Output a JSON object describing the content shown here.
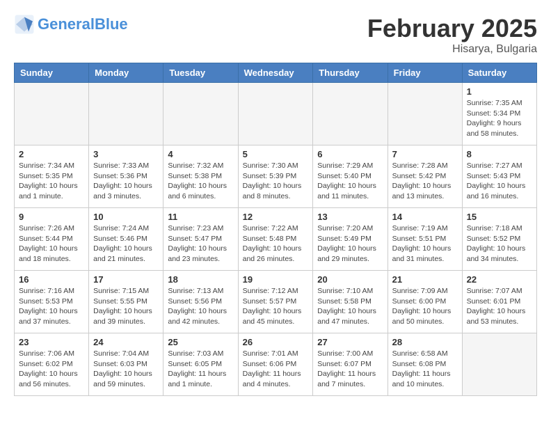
{
  "header": {
    "logo_line1": "General",
    "logo_line2": "Blue",
    "title": "February 2025",
    "subtitle": "Hisarya, Bulgaria"
  },
  "weekdays": [
    "Sunday",
    "Monday",
    "Tuesday",
    "Wednesday",
    "Thursday",
    "Friday",
    "Saturday"
  ],
  "weeks": [
    [
      {
        "day": "",
        "info": ""
      },
      {
        "day": "",
        "info": ""
      },
      {
        "day": "",
        "info": ""
      },
      {
        "day": "",
        "info": ""
      },
      {
        "day": "",
        "info": ""
      },
      {
        "day": "",
        "info": ""
      },
      {
        "day": "1",
        "info": "Sunrise: 7:35 AM\nSunset: 5:34 PM\nDaylight: 9 hours and 58 minutes."
      }
    ],
    [
      {
        "day": "2",
        "info": "Sunrise: 7:34 AM\nSunset: 5:35 PM\nDaylight: 10 hours and 1 minute."
      },
      {
        "day": "3",
        "info": "Sunrise: 7:33 AM\nSunset: 5:36 PM\nDaylight: 10 hours and 3 minutes."
      },
      {
        "day": "4",
        "info": "Sunrise: 7:32 AM\nSunset: 5:38 PM\nDaylight: 10 hours and 6 minutes."
      },
      {
        "day": "5",
        "info": "Sunrise: 7:30 AM\nSunset: 5:39 PM\nDaylight: 10 hours and 8 minutes."
      },
      {
        "day": "6",
        "info": "Sunrise: 7:29 AM\nSunset: 5:40 PM\nDaylight: 10 hours and 11 minutes."
      },
      {
        "day": "7",
        "info": "Sunrise: 7:28 AM\nSunset: 5:42 PM\nDaylight: 10 hours and 13 minutes."
      },
      {
        "day": "8",
        "info": "Sunrise: 7:27 AM\nSunset: 5:43 PM\nDaylight: 10 hours and 16 minutes."
      }
    ],
    [
      {
        "day": "9",
        "info": "Sunrise: 7:26 AM\nSunset: 5:44 PM\nDaylight: 10 hours and 18 minutes."
      },
      {
        "day": "10",
        "info": "Sunrise: 7:24 AM\nSunset: 5:46 PM\nDaylight: 10 hours and 21 minutes."
      },
      {
        "day": "11",
        "info": "Sunrise: 7:23 AM\nSunset: 5:47 PM\nDaylight: 10 hours and 23 minutes."
      },
      {
        "day": "12",
        "info": "Sunrise: 7:22 AM\nSunset: 5:48 PM\nDaylight: 10 hours and 26 minutes."
      },
      {
        "day": "13",
        "info": "Sunrise: 7:20 AM\nSunset: 5:49 PM\nDaylight: 10 hours and 29 minutes."
      },
      {
        "day": "14",
        "info": "Sunrise: 7:19 AM\nSunset: 5:51 PM\nDaylight: 10 hours and 31 minutes."
      },
      {
        "day": "15",
        "info": "Sunrise: 7:18 AM\nSunset: 5:52 PM\nDaylight: 10 hours and 34 minutes."
      }
    ],
    [
      {
        "day": "16",
        "info": "Sunrise: 7:16 AM\nSunset: 5:53 PM\nDaylight: 10 hours and 37 minutes."
      },
      {
        "day": "17",
        "info": "Sunrise: 7:15 AM\nSunset: 5:55 PM\nDaylight: 10 hours and 39 minutes."
      },
      {
        "day": "18",
        "info": "Sunrise: 7:13 AM\nSunset: 5:56 PM\nDaylight: 10 hours and 42 minutes."
      },
      {
        "day": "19",
        "info": "Sunrise: 7:12 AM\nSunset: 5:57 PM\nDaylight: 10 hours and 45 minutes."
      },
      {
        "day": "20",
        "info": "Sunrise: 7:10 AM\nSunset: 5:58 PM\nDaylight: 10 hours and 47 minutes."
      },
      {
        "day": "21",
        "info": "Sunrise: 7:09 AM\nSunset: 6:00 PM\nDaylight: 10 hours and 50 minutes."
      },
      {
        "day": "22",
        "info": "Sunrise: 7:07 AM\nSunset: 6:01 PM\nDaylight: 10 hours and 53 minutes."
      }
    ],
    [
      {
        "day": "23",
        "info": "Sunrise: 7:06 AM\nSunset: 6:02 PM\nDaylight: 10 hours and 56 minutes."
      },
      {
        "day": "24",
        "info": "Sunrise: 7:04 AM\nSunset: 6:03 PM\nDaylight: 10 hours and 59 minutes."
      },
      {
        "day": "25",
        "info": "Sunrise: 7:03 AM\nSunset: 6:05 PM\nDaylight: 11 hours and 1 minute."
      },
      {
        "day": "26",
        "info": "Sunrise: 7:01 AM\nSunset: 6:06 PM\nDaylight: 11 hours and 4 minutes."
      },
      {
        "day": "27",
        "info": "Sunrise: 7:00 AM\nSunset: 6:07 PM\nDaylight: 11 hours and 7 minutes."
      },
      {
        "day": "28",
        "info": "Sunrise: 6:58 AM\nSunset: 6:08 PM\nDaylight: 11 hours and 10 minutes."
      },
      {
        "day": "",
        "info": ""
      }
    ]
  ]
}
